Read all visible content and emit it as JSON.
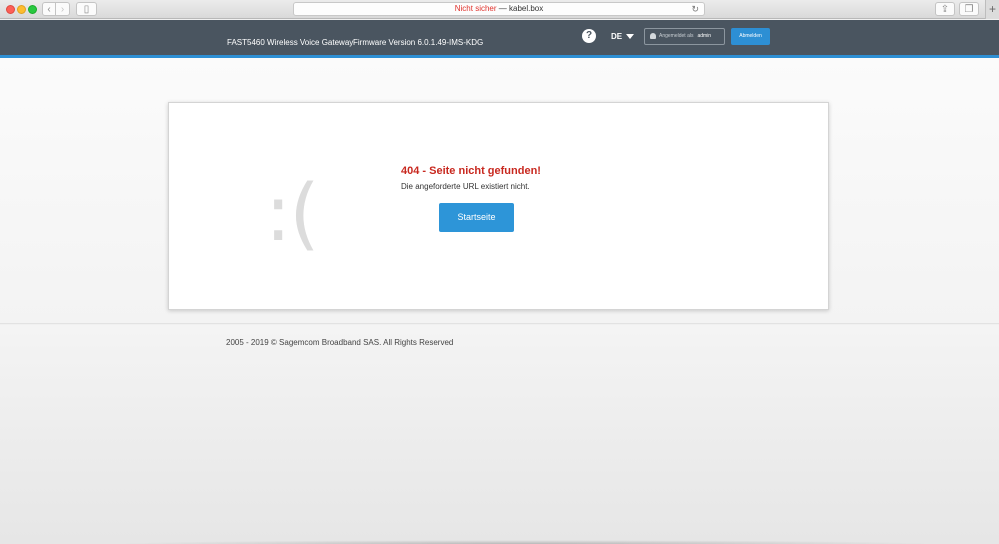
{
  "browser": {
    "url_insecure": "Nicht sicher",
    "url_separator": " — ",
    "url_host": "kabel.box"
  },
  "header": {
    "device": "FAST5460 Wireless Voice Gateway",
    "firmware": "Firmware Version 6.0.1.49-IMS-KDG",
    "help": "?",
    "language": "DE",
    "logged_in_label": "Angemeldet als",
    "username": "admin",
    "logout": "Abmelden"
  },
  "error": {
    "face": ":(",
    "title": "404 - Seite nicht gefunden!",
    "message": "Die angeforderte URL existiert nicht.",
    "button": "Startseite"
  },
  "footer": {
    "copyright": "2005 - 2019 © Sagemcom Broadband SAS. All Rights Reserved"
  },
  "colors": {
    "header_bg": "#4a5560",
    "accent": "#2d8fd4",
    "error": "#c8281f"
  }
}
